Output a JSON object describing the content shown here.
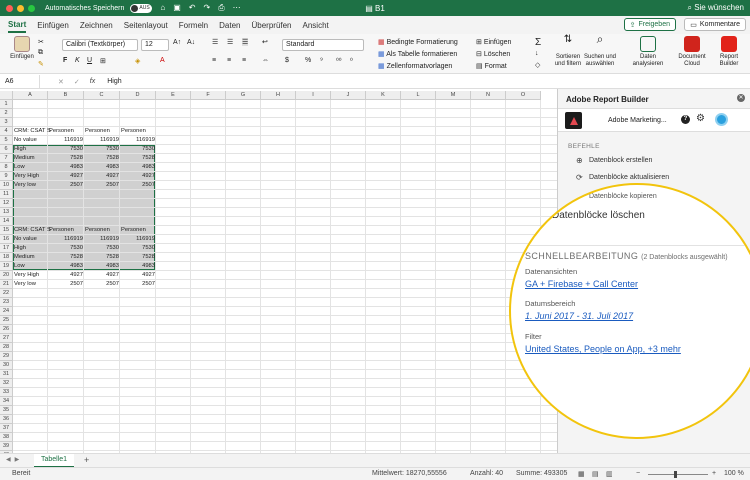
{
  "titlebar": {
    "autosave_label": "Automatisches Speichern",
    "autosave_state": "AUS",
    "title": "B1",
    "tell_me": "Sie wünschen"
  },
  "tabs": [
    "Start",
    "Einfügen",
    "Zeichnen",
    "Seitenlayout",
    "Formeln",
    "Daten",
    "Überprüfen",
    "Ansicht"
  ],
  "tabs_active": "Start",
  "top_buttons": {
    "share": "Freigeben",
    "comments": "Kommentare"
  },
  "ribbon": {
    "paste": "Einfügen",
    "font_name": "Calibri (Textkörper)",
    "font_size": "12",
    "number_format": "Standard",
    "cond_format": "Bedingte Formatierung",
    "as_table": "Als Tabelle formatieren",
    "cell_styles": "Zellenformatvorlagen",
    "insert": "Einfügen",
    "delete": "Löschen",
    "format": "Format",
    "sort_filter": "Sortieren\nund filtern",
    "find_select": "Suchen und\nauswählen",
    "analyze": "Daten\nanalysieren",
    "document_cloud": "Document\nCloud",
    "report_builder": "Report\nBuilder"
  },
  "formula_bar": {
    "name_box": "A6",
    "fx": "fx",
    "value": "High"
  },
  "columns": [
    "A",
    "B",
    "C",
    "D",
    "E",
    "F",
    "G",
    "H",
    "I",
    "J",
    "K",
    "L",
    "M",
    "N",
    "O"
  ],
  "rows": [
    "1",
    "2",
    "3",
    "4",
    "5",
    "6",
    "7",
    "8",
    "9",
    "10",
    "11",
    "12",
    "13",
    "14",
    "15",
    "16",
    "17",
    "18",
    "19",
    "20",
    "21",
    "22",
    "23",
    "24",
    "25",
    "26",
    "27",
    "28",
    "29",
    "30",
    "31",
    "32",
    "33",
    "34",
    "35",
    "36",
    "37",
    "38",
    "39",
    "40"
  ],
  "cells": [
    {
      "r": 4,
      "c": 0,
      "v": "CRM: CSAT S",
      "n": false
    },
    {
      "r": 4,
      "c": 1,
      "v": "Personen",
      "n": false
    },
    {
      "r": 4,
      "c": 2,
      "v": "Personen",
      "n": false
    },
    {
      "r": 4,
      "c": 3,
      "v": "Personen",
      "n": false
    },
    {
      "r": 5,
      "c": 0,
      "v": "No value",
      "n": false
    },
    {
      "r": 5,
      "c": 1,
      "v": "116919",
      "n": true
    },
    {
      "r": 5,
      "c": 2,
      "v": "116919",
      "n": true
    },
    {
      "r": 5,
      "c": 3,
      "v": "116919",
      "n": true
    },
    {
      "r": 6,
      "c": 0,
      "v": "High",
      "n": false
    },
    {
      "r": 6,
      "c": 1,
      "v": "7530",
      "n": true
    },
    {
      "r": 6,
      "c": 2,
      "v": "7530",
      "n": true
    },
    {
      "r": 6,
      "c": 3,
      "v": "7530",
      "n": true
    },
    {
      "r": 7,
      "c": 0,
      "v": "Medium",
      "n": false
    },
    {
      "r": 7,
      "c": 1,
      "v": "7528",
      "n": true
    },
    {
      "r": 7,
      "c": 2,
      "v": "7528",
      "n": true
    },
    {
      "r": 7,
      "c": 3,
      "v": "7528",
      "n": true
    },
    {
      "r": 8,
      "c": 0,
      "v": "Low",
      "n": false
    },
    {
      "r": 8,
      "c": 1,
      "v": "4983",
      "n": true
    },
    {
      "r": 8,
      "c": 2,
      "v": "4983",
      "n": true
    },
    {
      "r": 8,
      "c": 3,
      "v": "4983",
      "n": true
    },
    {
      "r": 9,
      "c": 0,
      "v": "Very High",
      "n": false
    },
    {
      "r": 9,
      "c": 1,
      "v": "4927",
      "n": true
    },
    {
      "r": 9,
      "c": 2,
      "v": "4927",
      "n": true
    },
    {
      "r": 9,
      "c": 3,
      "v": "4927",
      "n": true
    },
    {
      "r": 10,
      "c": 0,
      "v": "Very low",
      "n": false
    },
    {
      "r": 10,
      "c": 1,
      "v": "2507",
      "n": true
    },
    {
      "r": 10,
      "c": 2,
      "v": "2507",
      "n": true
    },
    {
      "r": 10,
      "c": 3,
      "v": "2507",
      "n": true
    },
    {
      "r": 15,
      "c": 0,
      "v": "CRM: CSAT S",
      "n": false
    },
    {
      "r": 15,
      "c": 1,
      "v": "Personen",
      "n": false
    },
    {
      "r": 15,
      "c": 2,
      "v": "Personen",
      "n": false
    },
    {
      "r": 15,
      "c": 3,
      "v": "Personen",
      "n": false
    },
    {
      "r": 16,
      "c": 0,
      "v": "No value",
      "n": false
    },
    {
      "r": 16,
      "c": 1,
      "v": "116919",
      "n": true
    },
    {
      "r": 16,
      "c": 2,
      "v": "116919",
      "n": true
    },
    {
      "r": 16,
      "c": 3,
      "v": "116919",
      "n": true
    },
    {
      "r": 17,
      "c": 0,
      "v": "High",
      "n": false
    },
    {
      "r": 17,
      "c": 1,
      "v": "7530",
      "n": true
    },
    {
      "r": 17,
      "c": 2,
      "v": "7530",
      "n": true
    },
    {
      "r": 17,
      "c": 3,
      "v": "7530",
      "n": true
    },
    {
      "r": 18,
      "c": 0,
      "v": "Medium",
      "n": false
    },
    {
      "r": 18,
      "c": 1,
      "v": "7528",
      "n": true
    },
    {
      "r": 18,
      "c": 2,
      "v": "7528",
      "n": true
    },
    {
      "r": 18,
      "c": 3,
      "v": "7528",
      "n": true
    },
    {
      "r": 19,
      "c": 0,
      "v": "Low",
      "n": false
    },
    {
      "r": 19,
      "c": 1,
      "v": "4983",
      "n": true
    },
    {
      "r": 19,
      "c": 2,
      "v": "4983",
      "n": true
    },
    {
      "r": 19,
      "c": 3,
      "v": "4983",
      "n": true
    },
    {
      "r": 20,
      "c": 0,
      "v": "Very High",
      "n": false
    },
    {
      "r": 20,
      "c": 1,
      "v": "4927",
      "n": true
    },
    {
      "r": 20,
      "c": 2,
      "v": "4927",
      "n": true
    },
    {
      "r": 20,
      "c": 3,
      "v": "4927",
      "n": true
    },
    {
      "r": 21,
      "c": 0,
      "v": "Very low",
      "n": false
    },
    {
      "r": 21,
      "c": 1,
      "v": "2507",
      "n": true
    },
    {
      "r": 21,
      "c": 2,
      "v": "2507",
      "n": true
    },
    {
      "r": 21,
      "c": 3,
      "v": "2507",
      "n": true
    }
  ],
  "sheet_tab": "Tabelle1",
  "status": {
    "ready": "Bereit",
    "average": "Mittelwert: 18270,55556",
    "count": "Anzahl: 40",
    "sum": "Summe: 493305",
    "zoom": "100 %"
  },
  "panel": {
    "title": "Adobe Report Builder",
    "org": "Adobe Marketing...",
    "commands_label": "BEFEHLE",
    "create": "Datenblock erstellen",
    "refresh": "Datenblöcke aktualisieren",
    "copy_peek": "Datenblöcke kopieren",
    "delete": "Datenblöcke löschen",
    "quick_edit": "SCHNELLBEARBEITUNG",
    "quick_edit_note": "(2 Datenblocks ausgewählt)",
    "views_label": "Datenansichten",
    "views_value": "GA + Firebase + Call Center",
    "range_label": "Datumsbereich",
    "range_value": "1. Juni 2017 - 31. Juli 2017",
    "filter_label": "Filter",
    "filter_value": "United States, People on App, +3 mehr"
  },
  "colors": {
    "excel_green": "#1e7145",
    "highlight_ring": "#f2c40d",
    "link_blue": "#1a5bbf"
  }
}
